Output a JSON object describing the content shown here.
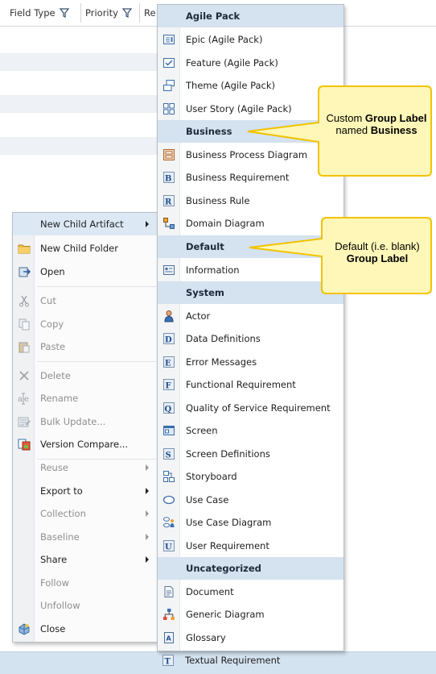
{
  "grid": {
    "columns": [
      "Field Type",
      "Priority",
      "Re"
    ],
    "filter_icon": "filter-icon"
  },
  "context_menu": {
    "items": [
      {
        "label": "New Child Artifact",
        "icon": "",
        "disabled": false,
        "submenu": true,
        "highlighted": true
      },
      {
        "label": "New Child Folder",
        "icon": "folder-icon",
        "disabled": false,
        "submenu": false
      },
      {
        "label": "Open",
        "icon": "open-icon",
        "disabled": false,
        "submenu": false
      },
      {
        "label": "Cut",
        "icon": "scissors-icon",
        "disabled": true,
        "submenu": false
      },
      {
        "label": "Copy",
        "icon": "copy-icon",
        "disabled": true,
        "submenu": false
      },
      {
        "label": "Paste",
        "icon": "paste-icon",
        "disabled": true,
        "submenu": false
      },
      {
        "label": "Delete",
        "icon": "delete-icon",
        "disabled": true,
        "submenu": false
      },
      {
        "label": "Rename",
        "icon": "rename-icon",
        "disabled": true,
        "submenu": false
      },
      {
        "label": "Bulk Update...",
        "icon": "bulk-update-icon",
        "disabled": true,
        "submenu": false
      },
      {
        "label": "Version Compare...",
        "icon": "version-compare-icon",
        "disabled": false,
        "submenu": false
      },
      {
        "label": "Reuse",
        "icon": "",
        "disabled": true,
        "submenu": true
      },
      {
        "label": "Export to",
        "icon": "",
        "disabled": false,
        "submenu": true
      },
      {
        "label": "Collection",
        "icon": "",
        "disabled": true,
        "submenu": true
      },
      {
        "label": "Baseline",
        "icon": "",
        "disabled": true,
        "submenu": true
      },
      {
        "label": "Share",
        "icon": "",
        "disabled": false,
        "submenu": true
      },
      {
        "label": "Follow",
        "icon": "",
        "disabled": true,
        "submenu": false
      },
      {
        "label": "Unfollow",
        "icon": "",
        "disabled": true,
        "submenu": false
      },
      {
        "label": "Close",
        "icon": "close-icon",
        "disabled": false,
        "submenu": false
      }
    ]
  },
  "submenu": {
    "groups": [
      {
        "label": "Agile Pack",
        "items": [
          {
            "label": "Epic (Agile Pack)",
            "icon": "epic-icon"
          },
          {
            "label": "Feature (Agile Pack)",
            "icon": "feature-icon"
          },
          {
            "label": "Theme (Agile Pack)",
            "icon": "theme-icon"
          },
          {
            "label": "User Story (Agile Pack)",
            "icon": "user-story-icon"
          }
        ]
      },
      {
        "label": "Business",
        "items": [
          {
            "label": "Business Process Diagram",
            "icon": "business-process-diagram-icon"
          },
          {
            "label": "Business Requirement",
            "icon": "business-requirement-icon"
          },
          {
            "label": "Business Rule",
            "icon": "business-rule-icon"
          },
          {
            "label": "Domain Diagram",
            "icon": "domain-diagram-icon"
          }
        ]
      },
      {
        "label": "Default",
        "items": [
          {
            "label": "Information",
            "icon": "information-icon"
          }
        ]
      },
      {
        "label": "System",
        "items": [
          {
            "label": "Actor",
            "icon": "actor-icon"
          },
          {
            "label": "Data Definitions",
            "icon": "data-definitions-icon"
          },
          {
            "label": "Error Messages",
            "icon": "error-messages-icon"
          },
          {
            "label": "Functional Requirement",
            "icon": "functional-requirement-icon"
          },
          {
            "label": "Quality of Service Requirement",
            "icon": "quality-of-service-icon"
          },
          {
            "label": "Screen",
            "icon": "screen-icon"
          },
          {
            "label": "Screen Definitions",
            "icon": "screen-definitions-icon"
          },
          {
            "label": "Storyboard",
            "icon": "storyboard-icon"
          },
          {
            "label": "Use Case",
            "icon": "use-case-icon"
          },
          {
            "label": "Use Case Diagram",
            "icon": "use-case-diagram-icon"
          },
          {
            "label": "User Requirement",
            "icon": "user-requirement-icon"
          }
        ]
      },
      {
        "label": "Uncategorized",
        "items": [
          {
            "label": "Document",
            "icon": "document-icon"
          },
          {
            "label": "Generic Diagram",
            "icon": "generic-diagram-icon"
          },
          {
            "label": "Glossary",
            "icon": "glossary-icon"
          },
          {
            "label": "Textual Requirement",
            "icon": "textual-requirement-icon"
          }
        ]
      }
    ]
  },
  "callouts": {
    "business": {
      "pre": "Custom ",
      "bold1": "Group Label",
      "mid": " named ",
      "bold2": "Business"
    },
    "default": {
      "pre": "Default (i.e. blank) ",
      "bold1": "Group Label"
    }
  },
  "colors": {
    "menu_header_bg": "#d5e2ef",
    "callout_fill": "#fff7b8",
    "callout_border": "#f2c300",
    "highlight": "#dce9f5"
  }
}
